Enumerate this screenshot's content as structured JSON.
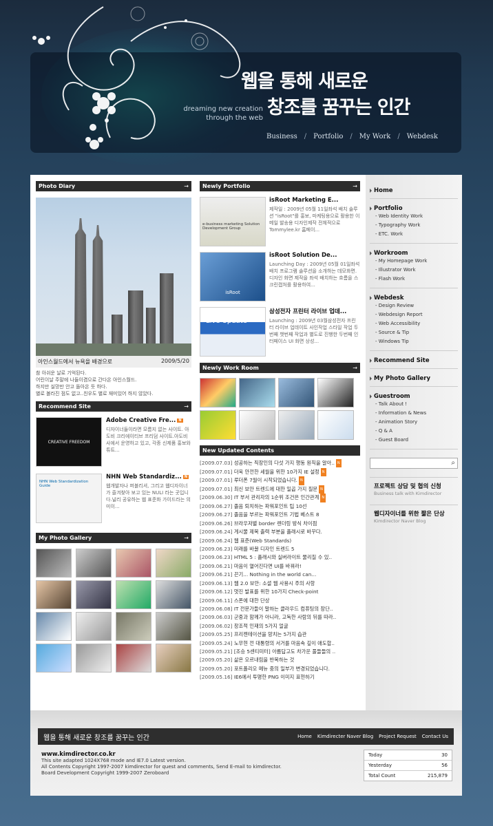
{
  "header": {
    "title_line1": "웹을 통해 새로운",
    "title_line2": "창조를 꿈꾸는 인간",
    "subtitle_line1": "dreaming new creation",
    "subtitle_line2": "through the web",
    "nav": [
      "Business",
      "Portfolio",
      "My Work",
      "Webdesk"
    ]
  },
  "photo_diary": {
    "title": "Photo Diary",
    "arrow": "→",
    "caption": "아인스월드에서 뉴욕을 배경으로",
    "date": "2009/5/20",
    "text": [
      "참 아쉬운 날로 기억된다.",
      "어린이날 주말에 나들이겸으로 간다온 아인스월드.",
      "하지만 실망만 안고 돌아온 듯 하다.",
      "별로 볼라진 점도 없고..친우도 별로 재미있어 하지 않았다."
    ]
  },
  "recommend_site": {
    "title": "Recommend Site",
    "arrow": "→",
    "items": [
      {
        "title": "Adobe Creative Fre...",
        "tag": "N",
        "thumb_text": "CREATIVE FREEDOM",
        "desc": "디자이너들이라면 모름지 없는 사이트. 아도비 크리에이티브 프리덤 사이트.아도비사에서 운영하고 있고, 각종 신제품 홍보와 튜트..."
      },
      {
        "title": "NHN Web Standardiz...",
        "tag": "N",
        "thumb_text": "NHN Web Standardization Guide",
        "desc": "웹개발자나 퍼블리셔, 그리고 웹디자이너가 즐겨찾아 보고 있는 NULI 라는 곳입니다.널리 공유하는 웹 표준화 가이드라는 의미이..."
      }
    ]
  },
  "my_photo_gallery": {
    "title": "My Photo Gallery",
    "arrow": "→"
  },
  "newly_portfolio": {
    "title": "Newly Portfolio",
    "arrow": "→",
    "items": [
      {
        "title": "isRoot Marketing E...",
        "thumb_text": "e-business marketing Solution Development Group",
        "desc": "제작일 : 2009년 05월 11일좌석 배치 솔루션 \"isRoot\"를 홍보, 마케팅용으로 활용한 이메일 발송용 디자인제작 전체적으로 Tommylee.kr 홈페이..."
      },
      {
        "title": "isRoot Solution De...",
        "thumb_text": "isRoot",
        "desc": "Launching Day : 2009년 05월 01일좌석 배치 프로그램 솔루션을 소개하는 데모화면. 디자인 화면 제작을 좌석 배치하는 흐름을 스크린캡처를 활용하여..."
      },
      {
        "title": "삼성전자 프린터 라이브 업데...",
        "thumb_text": "Live Update",
        "desc": "Launching : 2009년 03월삼성전자 프린터 라이브 업데이트 사인작업 스타일 작업 두번째 챗번째 작업과 별도로 진행한 두번째 인터페이스 UI 화면 상성..."
      }
    ]
  },
  "newly_work_room": {
    "title": "Newly Work Room",
    "arrow": "→"
  },
  "new_updated": {
    "title": "New Updated Contents",
    "items": [
      {
        "date": "[2009.07.03]",
        "text": "성공하는 직장인의 다섯 가지 행동 원칙을 알아..",
        "tag": true
      },
      {
        "date": "[2009.07.01]",
        "text": "더욱 안전한 세월을 위한 10가지 IE 설정",
        "tag": true
      },
      {
        "date": "[2009.07.01]",
        "text": "루더폰 7월이 시작되었습니다.",
        "tag": true
      },
      {
        "date": "[2009.07.01]",
        "text": "최신 보안 트렌드에 대한 일곱 가지 질문",
        "tag": true
      },
      {
        "date": "[2009.06.30]",
        "text": "IT 부서 관리자의 1순위 조건은 인간관계",
        "tag": true
      },
      {
        "date": "[2009.06.27]",
        "text": "졸음 퇴치하는 파워포인트 팁 10선",
        "tag": false
      },
      {
        "date": "[2009.06.27]",
        "text": "졸음을 부르는 파워포인트 기법 베스트 8",
        "tag": false
      },
      {
        "date": "[2009.06.26]",
        "text": "브라우저별 border 렌더링 방식 차이점",
        "tag": false
      },
      {
        "date": "[2009.06.24]",
        "text": "게시물 제목 출력 부분을 플래시로 바꾸다.",
        "tag": false
      },
      {
        "date": "[2009.06.24]",
        "text": "웹 표준(Web Standards)",
        "tag": false
      },
      {
        "date": "[2009.06.23]",
        "text": "미래를 바꿀 디자인 트렌드 5",
        "tag": false
      },
      {
        "date": "[2009.06.23]",
        "text": "HTML 5 : 플래시와 실버라이트 물리칠 수 있..",
        "tag": false
      },
      {
        "date": "[2009.06.21]",
        "text": "마음이 열어진다면 UI를 바꿔라!",
        "tag": false
      },
      {
        "date": "[2009.06.21]",
        "text": "끈기... Nothing in the world can...",
        "tag": false
      },
      {
        "date": "[2009.06.13]",
        "text": "웹 2.0 보안: 소셜 웹 사용시 주의 사항",
        "tag": false
      },
      {
        "date": "[2009.06.12]",
        "text": "멋진 발표를 위한 10가지 Check-point",
        "tag": false
      },
      {
        "date": "[2009.06.11]",
        "text": "스폰에 대한 단상",
        "tag": false
      },
      {
        "date": "[2009.06.08]",
        "text": "IT 전문가들이 말하는 클라우드 컴퓨팅의 장단..",
        "tag": false
      },
      {
        "date": "[2009.06.03]",
        "text": "군중과 함께가 아니라, 고독한 사람의 뒤를 따라..",
        "tag": false
      },
      {
        "date": "[2009.06.02]",
        "text": "창조적 인재의 5가지 얼굴",
        "tag": false
      },
      {
        "date": "[2009.05.25]",
        "text": "프리젠테이션을 망치는 5가지 습관",
        "tag": false
      },
      {
        "date": "[2009.05.24]",
        "text": "노무현 전 대통령의 서거를 마음속 깊이 애도합..",
        "tag": false
      },
      {
        "date": "[2009.05.21]",
        "text": "[조승 5센티미터] 아름답고도 차가운 풀들들의 ..",
        "tag": false
      },
      {
        "date": "[2009.05.20]",
        "text": "삶은 오르내림을 반복하는 것",
        "tag": false
      },
      {
        "date": "[2009.05.20]",
        "text": "포트폴리오 메뉴 중의 일부가 변경되었습니다.",
        "tag": false
      },
      {
        "date": "[2009.05.16]",
        "text": "IE6에서 투명한 PNG 이미지 표현하기",
        "tag": false
      }
    ]
  },
  "sidebar": {
    "groups": [
      {
        "label": "Home",
        "subs": []
      },
      {
        "label": "Portfolio",
        "subs": [
          "Web Identity Work",
          "Typography Work",
          "ETC. Work"
        ]
      },
      {
        "label": "Workroom",
        "subs": [
          "My Homepage Work",
          "Illustrator Work",
          "Flash Work"
        ]
      },
      {
        "label": "Webdesk",
        "subs": [
          "Design Review",
          "Webdesign Report",
          "Web Accessibility",
          "Source & Tip",
          "Windows Tip"
        ]
      },
      {
        "label": "Recommend Site",
        "subs": []
      },
      {
        "label": "My Photo Gallery",
        "subs": []
      },
      {
        "label": "Guestroom",
        "subs": [
          "Talk About !",
          "Information & News",
          "Animation Story",
          "Q & A",
          "Guest Board"
        ]
      }
    ],
    "search_icon": "magnifier-icon",
    "promos": [
      {
        "title": "프로젝트 상담 및 협의 신청",
        "desc": "Business talk with Kimdirector"
      },
      {
        "title": "웹디자이너를 위한 짧은 단상",
        "desc": "Kimdirector Naver Blog"
      }
    ]
  },
  "footer": {
    "title": "웹을 통해 새로운 창조를 꿈꾸는 인간",
    "links": [
      "Home",
      "Kimdirecter Naver Blog",
      "Project Request",
      "Contact Us"
    ],
    "url": "www.kimdirector.co.kr",
    "lines": [
      "This site adapted 1024X768 mode and IE7.0 Latest version.",
      "All Contents Copyright 1997-2007 kimdirector for quest and comments, Send E-mail to kimdirector.",
      "Board Development Copyright 1999-2007 Zeroboard"
    ],
    "counter": [
      {
        "label": "Today",
        "value": "30"
      },
      {
        "label": "Yesterday",
        "value": "56"
      },
      {
        "label": "Total Count",
        "value": "215,879"
      }
    ]
  },
  "colors": {
    "tag_orange": "#f08020",
    "bar_dark": "#2c2c2c"
  }
}
